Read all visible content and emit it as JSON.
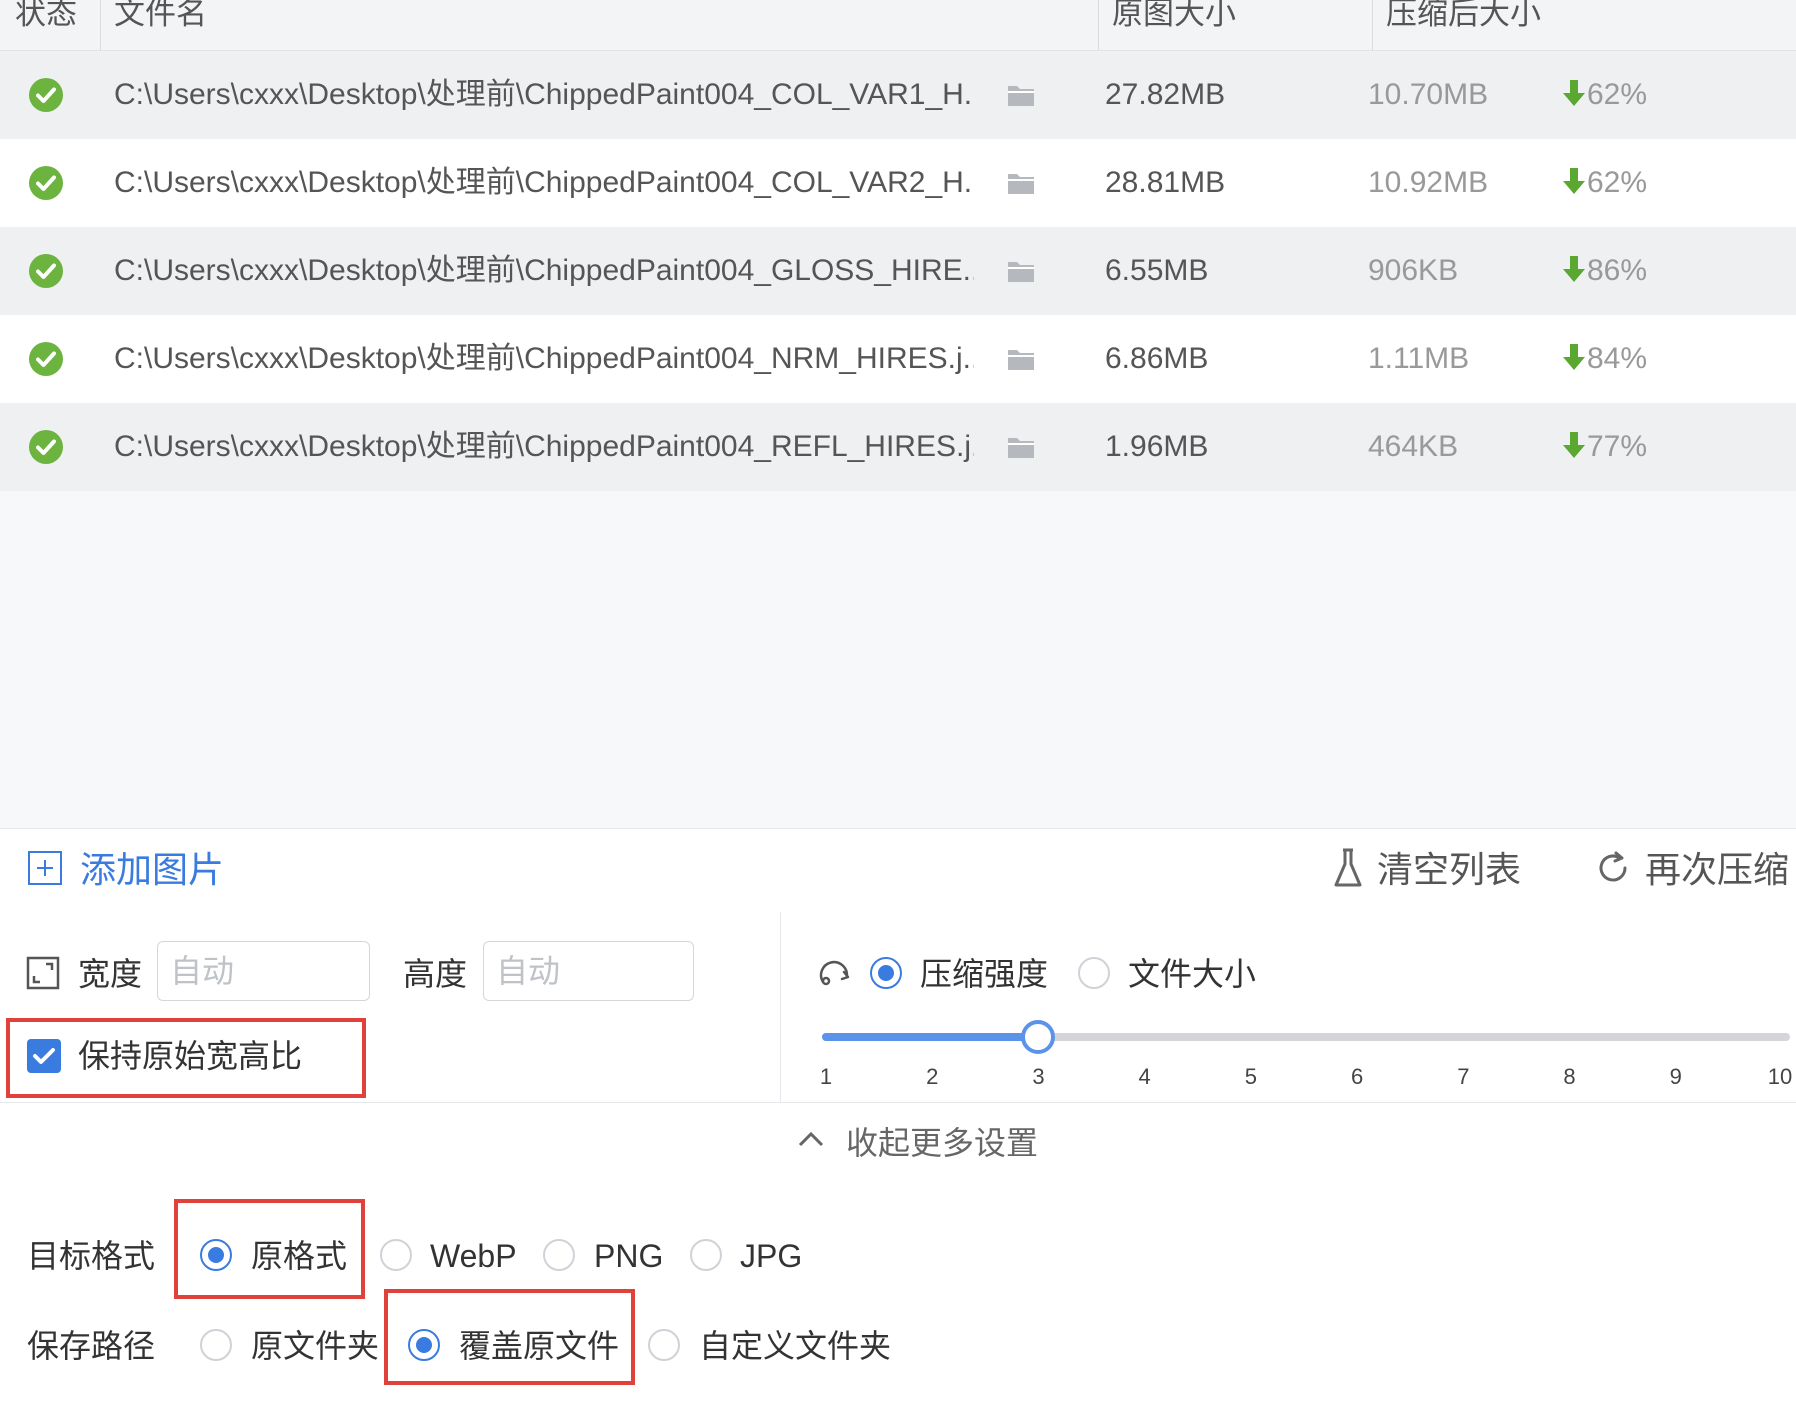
{
  "table": {
    "headers": {
      "status": "状态",
      "filename": "文件名",
      "original_size": "原图大小",
      "compressed_size": "压缩后大小"
    },
    "rows": [
      {
        "filename": "C:\\Users\\cxxx\\Desktop\\处理前\\ChippedPaint004_COL_VAR1_H...",
        "original": "27.82MB",
        "compressed": "10.70MB",
        "percent": "62%"
      },
      {
        "filename": "C:\\Users\\cxxx\\Desktop\\处理前\\ChippedPaint004_COL_VAR2_H...",
        "original": "28.81MB",
        "compressed": "10.92MB",
        "percent": "62%"
      },
      {
        "filename": "C:\\Users\\cxxx\\Desktop\\处理前\\ChippedPaint004_GLOSS_HIRE...",
        "original": "6.55MB",
        "compressed": "906KB",
        "percent": "86%"
      },
      {
        "filename": "C:\\Users\\cxxx\\Desktop\\处理前\\ChippedPaint004_NRM_HIRES.j...",
        "original": "6.86MB",
        "compressed": "1.11MB",
        "percent": "84%"
      },
      {
        "filename": "C:\\Users\\cxxx\\Desktop\\处理前\\ChippedPaint004_REFL_HIRES.j...",
        "original": "1.96MB",
        "compressed": "464KB",
        "percent": "77%"
      }
    ]
  },
  "actions": {
    "add": "添加图片",
    "clear": "清空列表",
    "recompress": "再次压缩"
  },
  "size": {
    "width_label": "宽度",
    "width_placeholder": "自动",
    "height_label": "高度",
    "height_placeholder": "自动",
    "keep_ratio": "保持原始宽高比",
    "keep_ratio_checked": true
  },
  "compress": {
    "mode_strength": "压缩强度",
    "mode_filesize": "文件大小",
    "selected_mode": "压缩强度",
    "slider_value": 3,
    "slider_min": 1,
    "slider_max": 10,
    "ticks": [
      "1",
      "2",
      "3",
      "4",
      "5",
      "6",
      "7",
      "8",
      "9",
      "10"
    ]
  },
  "collapse_label": "收起更多设置",
  "format": {
    "label": "目标格式",
    "options": [
      "原格式",
      "WebP",
      "PNG",
      "JPG"
    ],
    "selected": "原格式"
  },
  "save": {
    "label": "保存路径",
    "options": [
      "原文件夹",
      "覆盖原文件",
      "自定义文件夹"
    ],
    "selected": "覆盖原文件"
  },
  "colors": {
    "accent": "#3a7be0",
    "success": "#6cb33f",
    "highlight": "#e0413b"
  }
}
